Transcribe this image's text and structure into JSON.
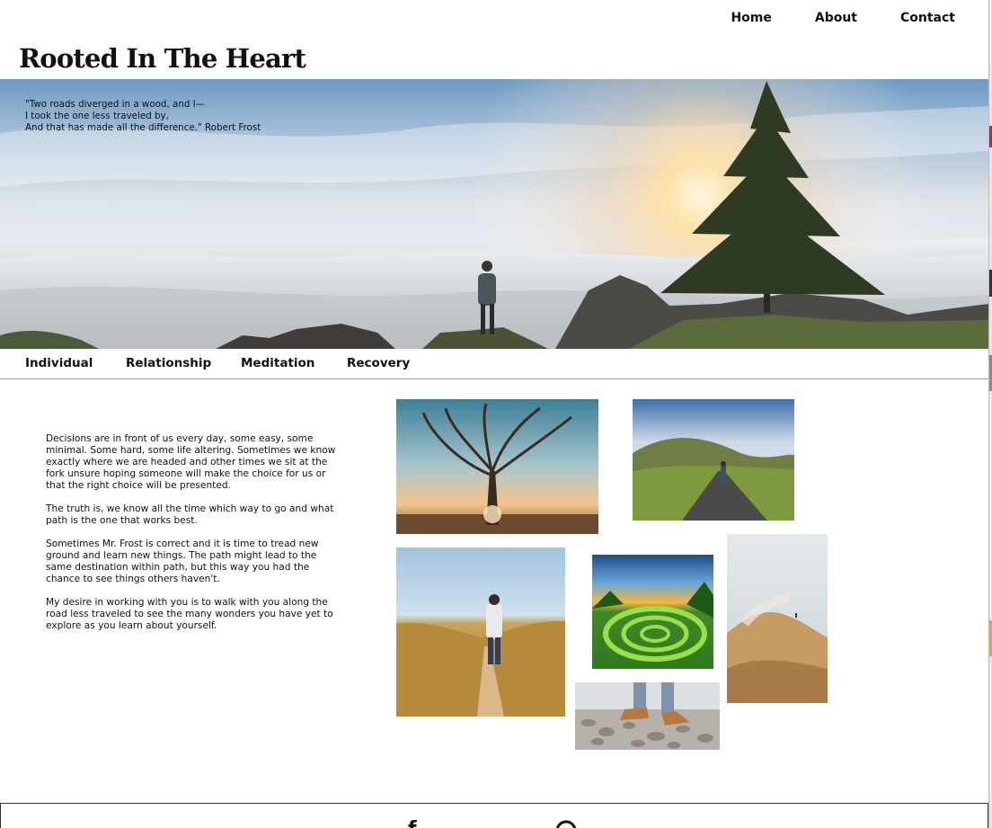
{
  "header": {
    "site_title": "Rooted In The Heart",
    "nav": [
      "Home",
      "About",
      "Contact"
    ]
  },
  "hero": {
    "quote": "\"Two roads diverged in a wood, and I—\nI took the one less traveled by,\nAnd that has made all the difference.\" Robert Frost"
  },
  "categories": [
    "Individual",
    "Relationship",
    "Meditation",
    "Recovery"
  ],
  "intro": {
    "paragraphs": [
      "Decisions are in front of us every day, some easy, some minimal. Some hard, some life altering. Sometimes we know exactly where we are headed and other times we sit at the fork unsure hoping someone will make the choice for us or that the right choice will be presented.",
      "The truth is, we know all the time which way to go and what path is the one that works best.",
      "Sometimes Mr. Frost is correct and it is time to tread new ground and learn new things. The path might lead to the same destination within path, but this way you had the chance to see things others haven't.",
      "My desire in working with you is to walk with you along the road less traveled to see the many wonders you have yet to explore as you learn about yourself."
    ]
  },
  "gallery": [
    {
      "name": "tree-sunset-photo"
    },
    {
      "name": "road-hills-photo"
    },
    {
      "name": "wheat-path-photo"
    },
    {
      "name": "green-spiral-photo"
    },
    {
      "name": "misty-ridge-photo"
    },
    {
      "name": "pebbles-feet-photo"
    }
  ],
  "footer": {
    "icons": [
      "facebook-icon",
      "pinterest-icon"
    ]
  },
  "colors": {
    "text": "#111111",
    "divider": "#9a9a9a",
    "background": "#ffffff"
  }
}
